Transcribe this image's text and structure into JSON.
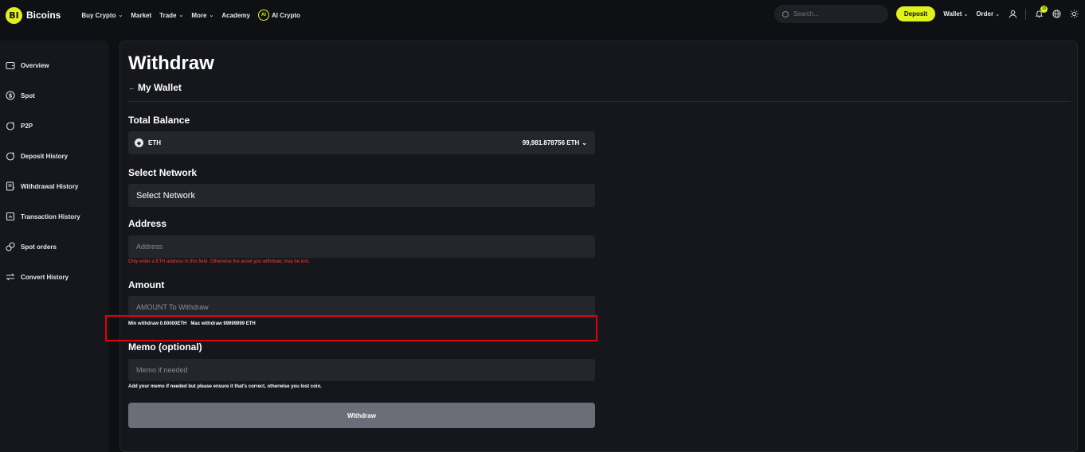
{
  "brand": {
    "logo_mark": "BI",
    "name": "Bicoins"
  },
  "nav": {
    "buy_crypto": "Buy Crypto",
    "market": "Market",
    "trade": "Trade",
    "more": "More",
    "academy": "Academy",
    "ai_crypto": "AI Crypto"
  },
  "header": {
    "search_placeholder": "Search...",
    "deposit": "Deposit",
    "wallet": "Wallet",
    "order": "Order",
    "notification_count": "10"
  },
  "sidebar": {
    "items": [
      {
        "label": "Overview",
        "icon": "wallet-icon"
      },
      {
        "label": "Spot",
        "icon": "dollar-icon"
      },
      {
        "label": "P2P",
        "icon": "p2p-icon"
      },
      {
        "label": "Deposit History",
        "icon": "deposit-icon"
      },
      {
        "label": "Withdrawal History",
        "icon": "withdrawal-icon"
      },
      {
        "label": "Transaction History",
        "icon": "transaction-icon"
      },
      {
        "label": "Spot orders",
        "icon": "orders-icon"
      },
      {
        "label": "Convert History",
        "icon": "convert-icon"
      }
    ]
  },
  "main": {
    "title": "Withdraw",
    "back": "My Wallet",
    "total_balance_label": "Total Balance",
    "coin": "ETH",
    "balance": "99,981.878756 ETH",
    "network_label": "Select Network",
    "network_value": "Select Network",
    "address_label": "Address",
    "address_placeholder": "Address",
    "address_hint": "Only enter a ETH address in this field. Otherwise the asset you withdraw, may be lost.",
    "amount_label": "Amount",
    "amount_placeholder": "AMOUNT To Withdraw",
    "min_withdraw": "Min withdraw 0.00000ETH",
    "max_withdraw": "Max withdraw 99999999 ETH",
    "memo_label": "Memo (optional)",
    "memo_placeholder": "Memo if needed",
    "memo_hint": "Add your memo if needed but please ensure it that's correct, otherwise you lost coin.",
    "withdraw_button": "Withdraw"
  },
  "colors": {
    "accent": "#dff21b",
    "error": "#ff3b30",
    "highlight": "#e0000a"
  }
}
